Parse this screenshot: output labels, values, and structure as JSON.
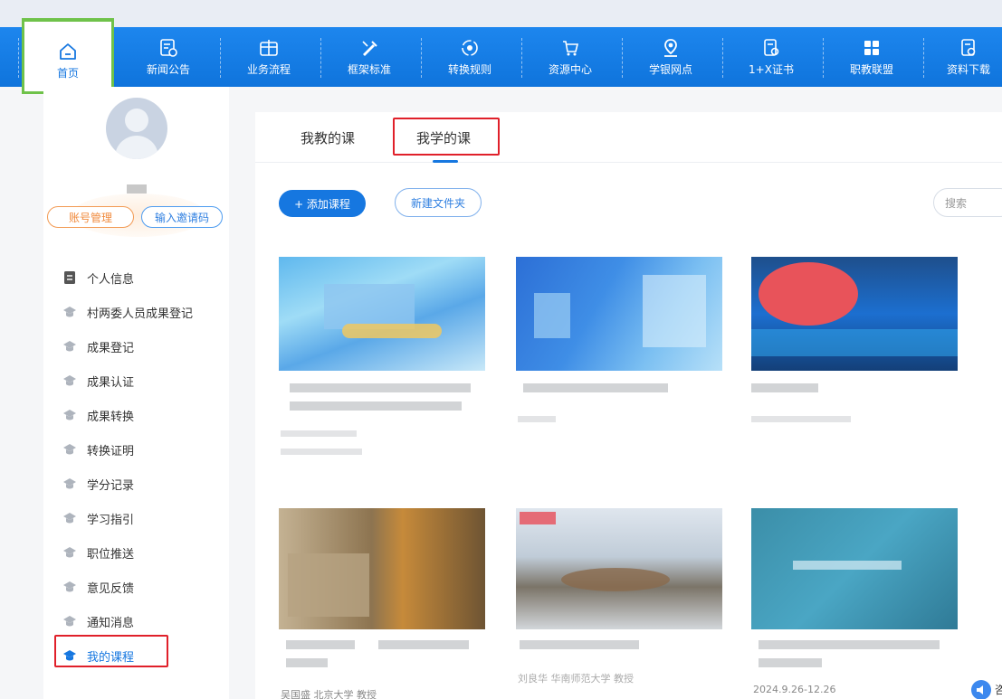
{
  "nav": {
    "home": "首页",
    "items": [
      "新闻公告",
      "业务流程",
      "框架标准",
      "转换规则",
      "资源中心",
      "学银网点",
      "1+X证书",
      "职教联盟",
      "资料下载"
    ]
  },
  "sidebar": {
    "account_button": "账号管理",
    "invite_button": "输入邀请码",
    "menu": [
      {
        "label": "个人信息",
        "icon": "document-icon"
      },
      {
        "label": "村两委人员成果登记",
        "icon": "grad-cap-icon"
      },
      {
        "label": "成果登记",
        "icon": "grad-cap-icon"
      },
      {
        "label": "成果认证",
        "icon": "grad-cap-icon"
      },
      {
        "label": "成果转换",
        "icon": "grad-cap-icon"
      },
      {
        "label": "转换证明",
        "icon": "grad-cap-icon"
      },
      {
        "label": "学分记录",
        "icon": "grad-cap-icon"
      },
      {
        "label": "学习指引",
        "icon": "grad-cap-icon"
      },
      {
        "label": "职位推送",
        "icon": "grad-cap-icon"
      },
      {
        "label": "意见反馈",
        "icon": "grad-cap-icon"
      },
      {
        "label": "通知消息",
        "icon": "grad-cap-icon"
      },
      {
        "label": "我的课程",
        "icon": "grad-cap-icon",
        "active": true
      }
    ]
  },
  "main": {
    "tabs": [
      "我教的课",
      "我学的课"
    ],
    "active_tab": "我学的课",
    "add_course": "+ 添加课程",
    "new_folder": "新建文件夹",
    "search_placeholder": "搜索",
    "cards_row2_meta": [
      "吴国盛 北京大学 教授",
      "刘良华 华南师范大学 教授",
      "2024.9.26-12.26"
    ]
  },
  "float": {
    "label": "咨"
  },
  "colors": {
    "primary": "#1677e0",
    "highlight": "#e0202a",
    "home_border": "#6fc24a",
    "account_pill": "#f08a3c"
  }
}
